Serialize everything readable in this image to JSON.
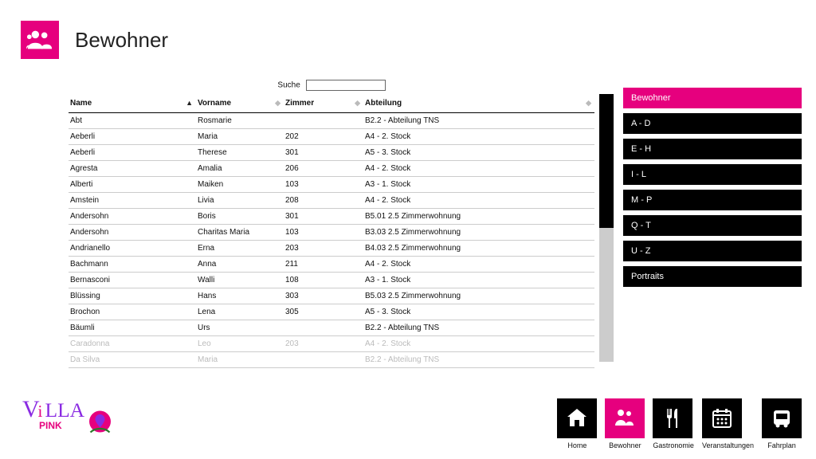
{
  "page_title": "Bewohner",
  "search": {
    "label": "Suche",
    "value": ""
  },
  "columns": {
    "name": "Name",
    "vorname": "Vorname",
    "zimmer": "Zimmer",
    "abteilung": "Abteilung"
  },
  "rows": [
    {
      "name": "Abt",
      "vorname": "Rosmarie",
      "zimmer": "",
      "abteilung": "B2.2 - Abteilung TNS"
    },
    {
      "name": "Aeberli",
      "vorname": "Maria",
      "zimmer": "202",
      "abteilung": "A4 - 2. Stock"
    },
    {
      "name": "Aeberli",
      "vorname": "Therese",
      "zimmer": "301",
      "abteilung": "A5 - 3. Stock"
    },
    {
      "name": "Agresta",
      "vorname": "Amalia",
      "zimmer": "206",
      "abteilung": "A4 - 2. Stock"
    },
    {
      "name": "Alberti",
      "vorname": "Maiken",
      "zimmer": "103",
      "abteilung": "A3 - 1. Stock"
    },
    {
      "name": "Amstein",
      "vorname": "Livia",
      "zimmer": "208",
      "abteilung": "A4 - 2. Stock"
    },
    {
      "name": "Andersohn",
      "vorname": "Boris",
      "zimmer": "301",
      "abteilung": "B5.01 2.5 Zimmerwohnung"
    },
    {
      "name": "Andersohn",
      "vorname": "Charitas Maria",
      "zimmer": "103",
      "abteilung": "B3.03 2.5 Zimmerwohnung"
    },
    {
      "name": "Andrianello",
      "vorname": "Erna",
      "zimmer": "203",
      "abteilung": "B4.03 2.5 Zimmerwohnung"
    },
    {
      "name": "Bachmann",
      "vorname": "Anna",
      "zimmer": "211",
      "abteilung": "A4 - 2. Stock"
    },
    {
      "name": "Bernasconi",
      "vorname": "Walli",
      "zimmer": "108",
      "abteilung": "A3 - 1. Stock"
    },
    {
      "name": "Blüssing",
      "vorname": "Hans",
      "zimmer": "303",
      "abteilung": "B5.03 2.5 Zimmerwohnung"
    },
    {
      "name": "Brochon",
      "vorname": "Lena",
      "zimmer": "305",
      "abteilung": "A5 - 3. Stock"
    },
    {
      "name": "Bäumli",
      "vorname": "Urs",
      "zimmer": "",
      "abteilung": "B2.2 - Abteilung TNS"
    },
    {
      "name": "Caradonna",
      "vorname": "Leo",
      "zimmer": "203",
      "abteilung": "A4 - 2. Stock",
      "faded": true
    },
    {
      "name": "Da Silva",
      "vorname": "Maria",
      "zimmer": "",
      "abteilung": "B2.2 - Abteilung TNS",
      "faded": true
    }
  ],
  "sidebar": [
    {
      "label": "Bewohner",
      "active": true
    },
    {
      "label": "A - D"
    },
    {
      "label": "E - H"
    },
    {
      "label": "I - L"
    },
    {
      "label": "M - P"
    },
    {
      "label": "Q - T"
    },
    {
      "label": "U - Z"
    },
    {
      "label": "Portraits"
    }
  ],
  "bottom_nav": [
    {
      "label": "Home",
      "icon": "home"
    },
    {
      "label": "Bewohner",
      "icon": "people",
      "active": true
    },
    {
      "label": "Gastronomie",
      "icon": "food"
    },
    {
      "label": "Veranstaltungen",
      "icon": "calendar"
    },
    {
      "label": "Fahrplan",
      "icon": "bus"
    }
  ],
  "logo": {
    "text_main": "ViLLA",
    "text_sub": "PINK"
  }
}
